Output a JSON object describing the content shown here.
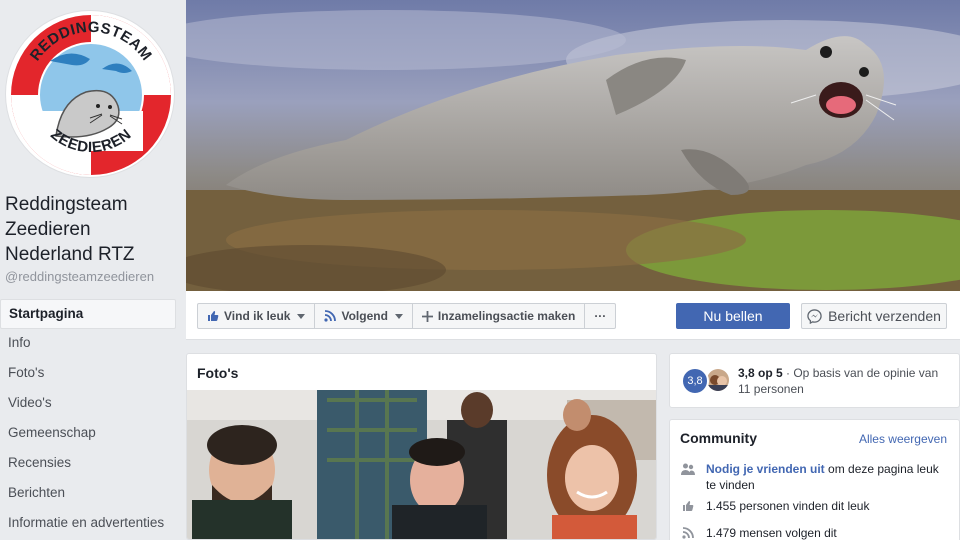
{
  "page": {
    "name": "Reddingsteam Zeedieren Nederland RTZ",
    "handle": "@reddingsteamzeedieren",
    "logo_text_top": "REDDINGSTEAM",
    "logo_text_bottom": "ZEEDIEREN"
  },
  "nav": {
    "items": [
      {
        "label": "Startpagina"
      },
      {
        "label": "Info"
      },
      {
        "label": "Foto's"
      },
      {
        "label": "Video's"
      },
      {
        "label": "Gemeenschap"
      },
      {
        "label": "Recensies"
      },
      {
        "label": "Berichten"
      },
      {
        "label": "Informatie en advertenties"
      }
    ]
  },
  "actions": {
    "like": "Vind ik leuk",
    "follow": "Volgend",
    "fundraiser": "Inzamelingsactie maken",
    "more": "···",
    "call": "Nu bellen",
    "message": "Bericht verzenden"
  },
  "photos": {
    "title": "Foto's"
  },
  "rating": {
    "badge": "3,8",
    "score": "3,8 op 5",
    "text": " · Op basis van de opinie van 11 personen"
  },
  "community": {
    "title": "Community",
    "see_all": "Alles weergeven",
    "invite_link": "Nodig je vrienden uit",
    "invite_text": " om deze pagina leuk te vinden",
    "likes": "1.455 personen vinden dit leuk",
    "follows": "1.479 mensen volgen dit"
  },
  "colors": {
    "accent": "#4267b2",
    "background": "#e9ebee",
    "logo_ring_red": "#e3262c"
  }
}
